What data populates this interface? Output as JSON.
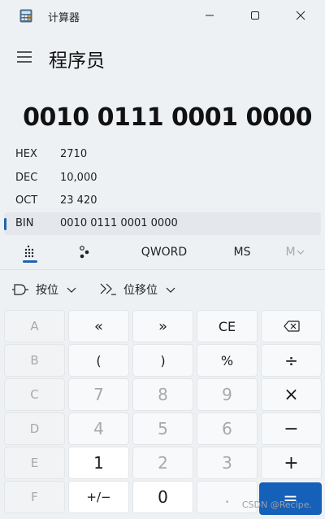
{
  "window": {
    "title": "计算器"
  },
  "mode": {
    "title": "程序员"
  },
  "display": {
    "value": "0010 0111 0001 0000"
  },
  "radix": [
    {
      "name": "HEX",
      "value": "2710",
      "active": false
    },
    {
      "name": "DEC",
      "value": "10,000",
      "active": false
    },
    {
      "name": "OCT",
      "value": "23 420",
      "active": false
    },
    {
      "name": "BIN",
      "value": "0010 0111 0001 0000",
      "active": true
    }
  ],
  "tabs": {
    "word_size": "QWORD",
    "ms": "MS",
    "mplus": "M"
  },
  "dropdowns": {
    "bitwise": "按位",
    "bitshift": "位移位"
  },
  "keys": {
    "row1": [
      "A",
      "«",
      "»",
      "CE",
      "⌫"
    ],
    "row2": [
      "B",
      "(",
      ")",
      "%",
      "÷"
    ],
    "row3": [
      "C",
      "7",
      "8",
      "9",
      "×"
    ],
    "row4": [
      "D",
      "4",
      "5",
      "6",
      "−"
    ],
    "row5": [
      "E",
      "1",
      "2",
      "3",
      "+"
    ],
    "row6": [
      "F",
      "+/−",
      "0",
      ".",
      "="
    ]
  },
  "watermark": "CSDN @Recipe."
}
